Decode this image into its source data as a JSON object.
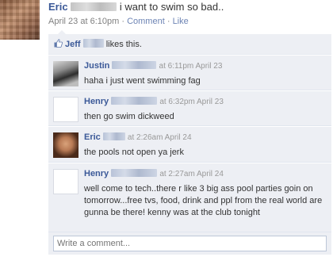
{
  "post": {
    "author_first": "Eric",
    "text": "i want to swim so bad..",
    "timestamp": "April 23 at 6:10pm",
    "separator": "·",
    "comment_link": "Comment",
    "like_link": "Like"
  },
  "likes": {
    "name": "Jeff",
    "text": "likes this."
  },
  "comments": [
    {
      "author": "Justin",
      "timestamp": "at 6:11pm April 23",
      "text": "haha i just went swimming fag"
    },
    {
      "author": "Henry",
      "timestamp": "at 6:32pm April 23",
      "text": "then go swim dickweed"
    },
    {
      "author": "Eric",
      "timestamp": "at 2:26am April 24",
      "text": "the pools not open ya jerk"
    },
    {
      "author": "Henry",
      "timestamp": "at 2:27am April 24",
      "text": "well come to tech..there r like 3 big ass pool parties goin on tomorrow...free tvs, food, drink and ppl from the real world are gunna be there! kenny was at the club tonight"
    }
  ],
  "comment_box": {
    "placeholder": "Write a comment..."
  },
  "colors": {
    "link": "#3b5998",
    "feedback_bg": "#edeff4",
    "meta": "#808080"
  },
  "icons": {
    "like": "thumbs-up-icon"
  }
}
